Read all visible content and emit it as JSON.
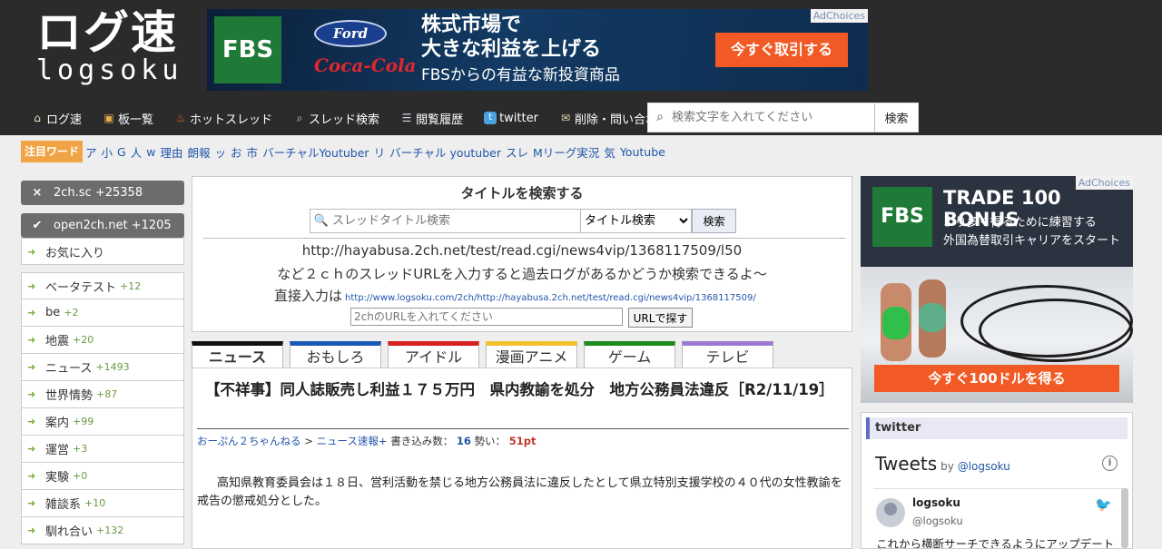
{
  "logo": {
    "main": "ログ速",
    "sub": "logsoku"
  },
  "top_ad": {
    "fbs": "FBS",
    "ford": "Ford",
    "coke": "Coca-Cola",
    "headline1": "株式市場で",
    "headline2": "大きな利益を上げる",
    "sub": "FBSからの有益な新投資商品",
    "cta": "今すぐ取引する",
    "adchoices": "AdChoices"
  },
  "nav": {
    "items": [
      {
        "icon": "home-icon",
        "label": "ログ速"
      },
      {
        "icon": "board-icon",
        "label": "板一覧"
      },
      {
        "icon": "fire-icon",
        "label": "ホットスレッド"
      },
      {
        "icon": "magnifier-icon",
        "label": "スレッド検索"
      },
      {
        "icon": "history-icon",
        "label": "閲覧履歴"
      },
      {
        "icon": "twitter-icon",
        "label": "twitter"
      },
      {
        "icon": "mail-icon",
        "label": "削除・問い合わせ"
      }
    ],
    "search_placeholder": "検索文字を入れてください",
    "search_button": "検索"
  },
  "keywords": {
    "label": "注目ワード",
    "items": [
      "ア",
      "小",
      "G",
      "人",
      "w",
      "理由",
      "朗報",
      "ッ",
      "お",
      "市",
      "バーチャルYoutuber",
      "リ",
      "バーチャル youtuber",
      "スレ",
      "Mリーグ実況",
      "気",
      "Youtube"
    ]
  },
  "left": {
    "boards": [
      {
        "icon": "×",
        "label": "2ch.sc +25358"
      },
      {
        "icon": "✔",
        "label": "open2ch.net +1205"
      }
    ],
    "favorite": "お気に入り",
    "menu": [
      {
        "label": "ベータテスト",
        "count": "+12"
      },
      {
        "label": "be",
        "count": "+2"
      },
      {
        "label": "地震",
        "count": "+20"
      },
      {
        "label": "ニュース",
        "count": "+1493"
      },
      {
        "label": "世界情勢",
        "count": "+87"
      },
      {
        "label": "案内",
        "count": "+99"
      },
      {
        "label": "運営",
        "count": "+3"
      },
      {
        "label": "実験",
        "count": "+0"
      },
      {
        "label": "雑談系",
        "count": "+10"
      },
      {
        "label": "馴れ合い",
        "count": "+132"
      }
    ]
  },
  "search_box": {
    "title": "タイトルを検索する",
    "placeholder": "スレッドタイトル検索",
    "select_value": "タイトル検索",
    "button": "検索",
    "url_example": "http://hayabusa.2ch.net/test/read.cgi/news4vip/1368117509/l50",
    "desc": "など２ｃｈのスレッドURLを入力すると過去ログがあるかどうか検索できるよ～",
    "direct_label": "直接入力は",
    "direct_example": "http://www.logsoku.com/2ch/http://hayabusa.2ch.net/test/read.cgi/news4vip/1368117509/",
    "url_placeholder": "2chのURLを入れてください",
    "url_button": "URLで探す"
  },
  "tabs": [
    {
      "label": "ニュース",
      "color": "#111111",
      "active": true
    },
    {
      "label": "おもしろ",
      "color": "#1a59b8"
    },
    {
      "label": "アイドル",
      "color": "#d92020"
    },
    {
      "label": "漫画アニメ",
      "color": "#f2c12e"
    },
    {
      "label": "ゲーム",
      "color": "#1e8a1e"
    },
    {
      "label": "テレビ",
      "color": "#9b7ad3"
    }
  ],
  "article": {
    "title": "【不祥事】同人誌販売し利益１７５万円　県内教諭を処分　地方公務員法違反［R2/11/19］",
    "source": "おーぷん２ちゃんねる",
    "board": "ニュース速報+",
    "posts_label": "書き込み数：",
    "posts": "16",
    "momentum_label": "勢い：",
    "momentum": "51pt",
    "body1": "　高知県教育委員会は１８日、営利活動を禁じる地方公務員法に違反したとして県立特別支援学校の４０代の女性教諭を",
    "body2": "戒告の懲戒処分とした。"
  },
  "right_ad": {
    "fbs": "FBS",
    "title": "TRADE 100 BONUS",
    "line1": "より多く得るために練習する",
    "line2": "外国為替取引キャリアをスタート",
    "cta": "今すぐ100ドルを得る",
    "adchoices": "AdChoices"
  },
  "twitter": {
    "header": "twitter",
    "title": "Tweets",
    "by": "by",
    "handle_link": "@logsoku",
    "name": "logsoku",
    "handle": "@logsoku",
    "text": "これから横断サーチできるようにアップデート"
  }
}
